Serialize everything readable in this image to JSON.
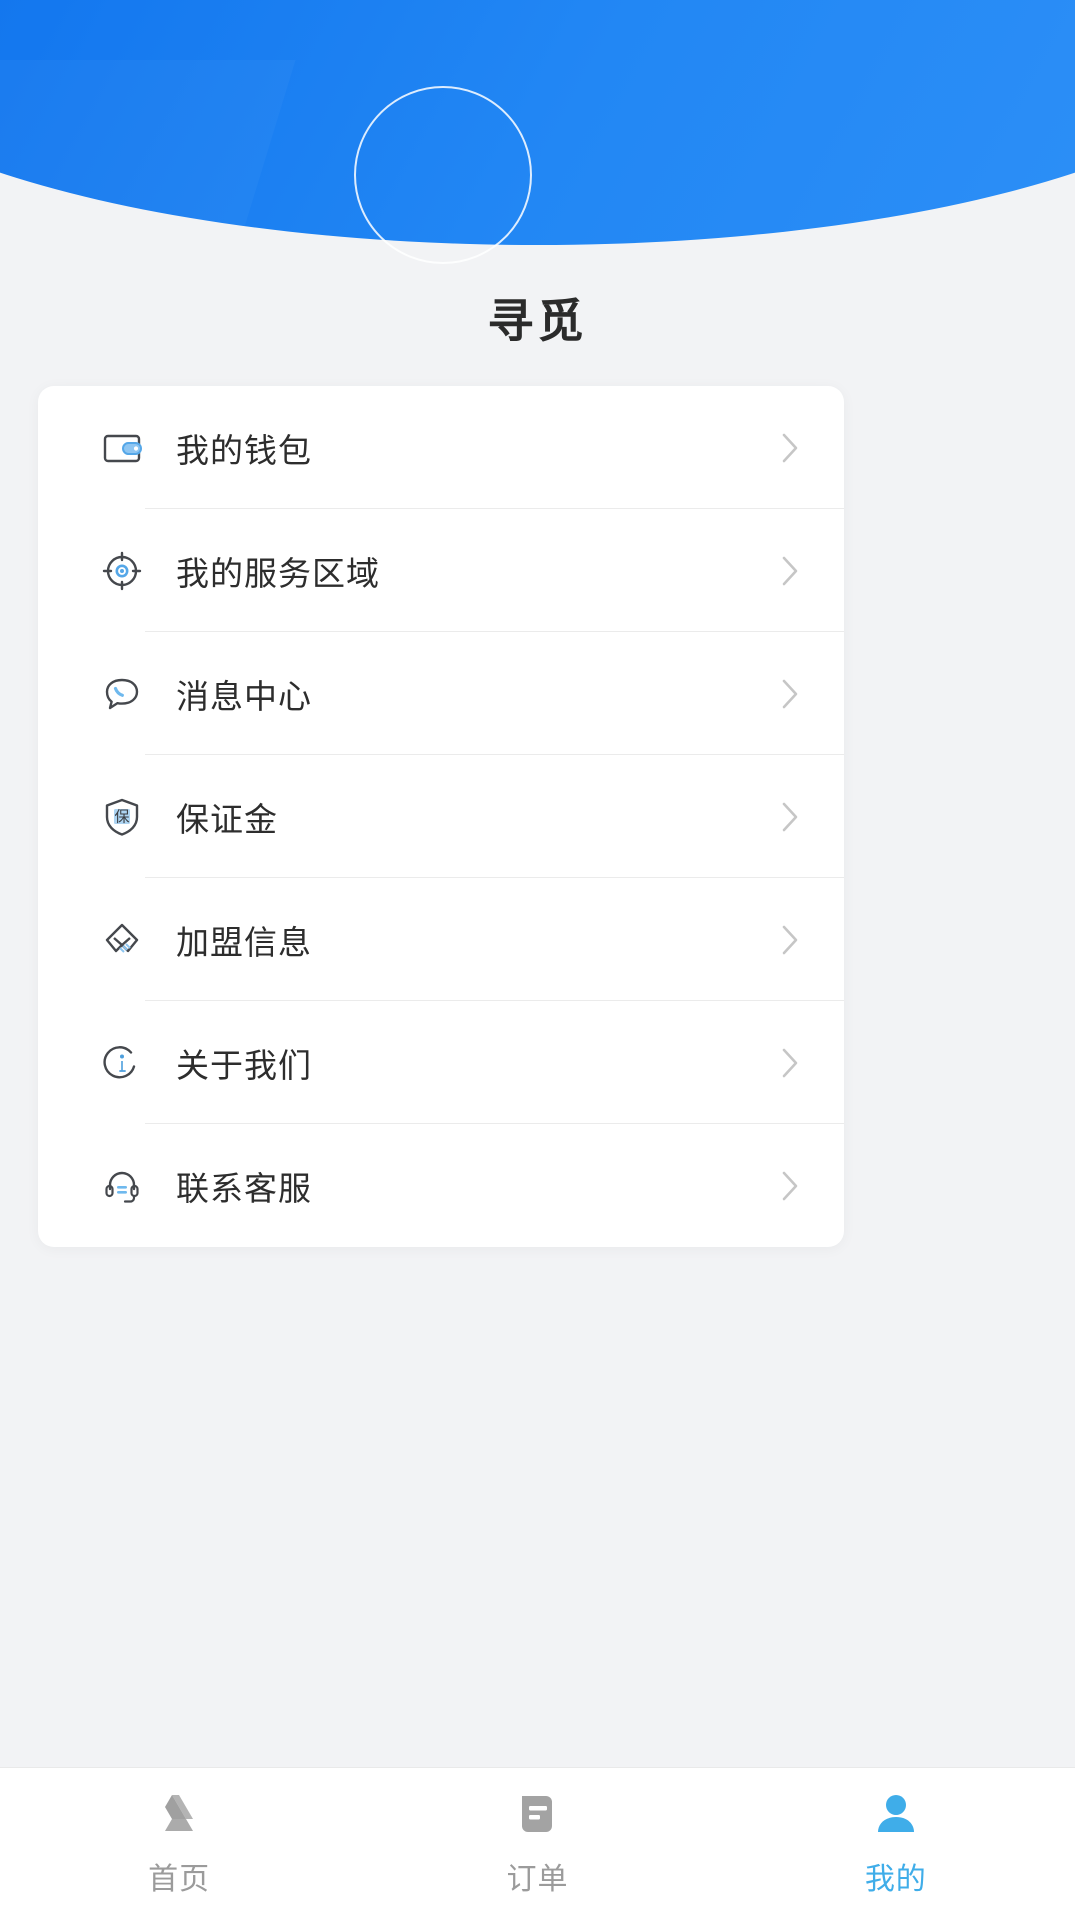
{
  "header": {
    "title": "寻觅",
    "avatar_placeholder": "",
    "brand_color": "#1478ef",
    "accent_color": "#3fade9"
  },
  "menu": {
    "items": [
      {
        "label": "我的钱包",
        "icon": "wallet-icon",
        "chevron": "chevron-right-icon"
      },
      {
        "label": "我的服务区域",
        "icon": "target-icon",
        "chevron": "chevron-right-icon"
      },
      {
        "label": "消息中心",
        "icon": "chat-bubble-icon",
        "chevron": "chevron-right-icon"
      },
      {
        "label": "保证金",
        "icon": "shield-bao-icon",
        "chevron": "chevron-right-icon",
        "icon_glyph": "保"
      },
      {
        "label": "加盟信息",
        "icon": "handshake-icon",
        "chevron": "chevron-right-icon"
      },
      {
        "label": "关于我们",
        "icon": "info-icon",
        "chevron": "chevron-right-icon"
      },
      {
        "label": "联系客服",
        "icon": "headset-icon",
        "chevron": "chevron-right-icon"
      }
    ]
  },
  "tabbar": {
    "tabs": [
      {
        "label": "首页",
        "icon": "home-triangle-icon",
        "active": false
      },
      {
        "label": "订单",
        "icon": "document-icon",
        "active": false
      },
      {
        "label": "我的",
        "icon": "person-icon",
        "active": true
      }
    ],
    "active_index": 2,
    "inactive_color": "#9b9b9b",
    "active_color": "#3fade9"
  }
}
